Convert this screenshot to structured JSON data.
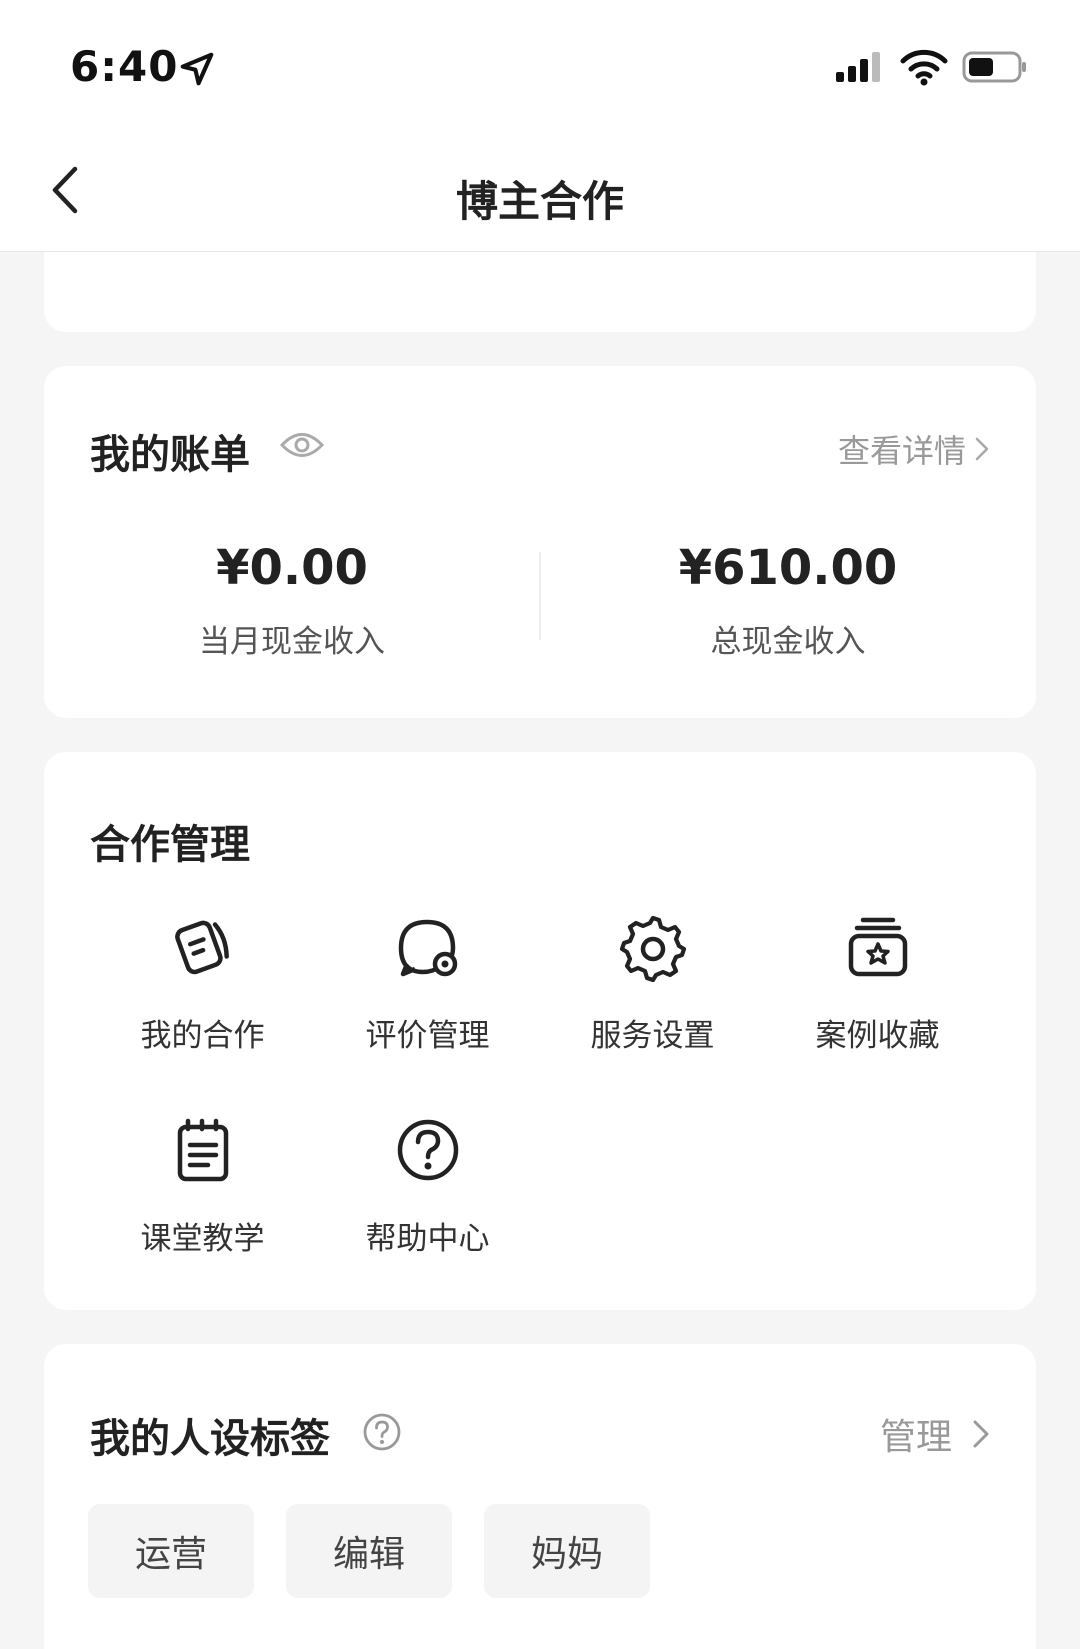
{
  "status_bar": {
    "time": "6:40"
  },
  "nav": {
    "title": "博主合作"
  },
  "bill": {
    "title": "我的账单",
    "detail_link": "查看详情",
    "monthly": {
      "amount": "¥0.00",
      "label": "当月现金收入"
    },
    "total": {
      "amount": "¥610.00",
      "label": "总现金收入"
    }
  },
  "manage": {
    "title": "合作管理",
    "items": [
      {
        "label": "我的合作",
        "icon": "cards-icon"
      },
      {
        "label": "评价管理",
        "icon": "chat-bubble-gear-icon"
      },
      {
        "label": "服务设置",
        "icon": "gear-icon"
      },
      {
        "label": "案例收藏",
        "icon": "star-box-icon"
      },
      {
        "label": "课堂教学",
        "icon": "notebook-icon"
      },
      {
        "label": "帮助中心",
        "icon": "question-circle-icon"
      }
    ]
  },
  "tags": {
    "title": "我的人设标签",
    "manage_link": "管理",
    "items": [
      "运营",
      "编辑",
      "妈妈"
    ]
  },
  "colors": {
    "background": "#f5f5f5",
    "card": "#ffffff",
    "text_primary": "#222222",
    "text_secondary": "#999999",
    "tag_bg": "#f4f4f4"
  }
}
